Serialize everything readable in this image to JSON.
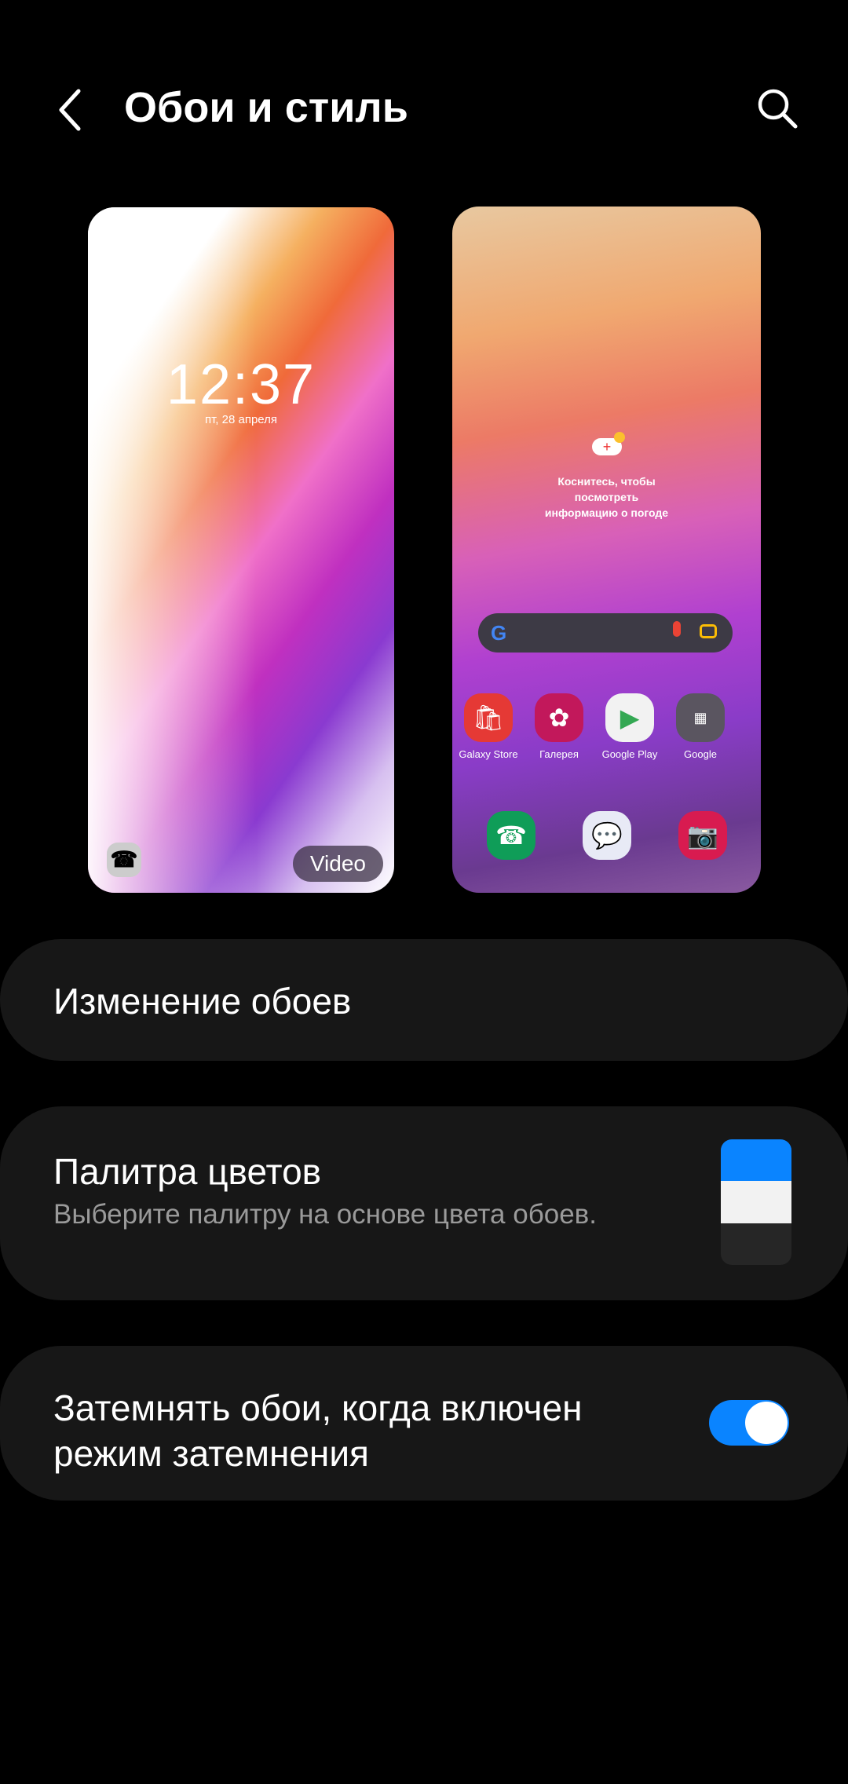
{
  "header": {
    "title": "Обои и стиль",
    "back_icon": "chevron-left-icon",
    "search_icon": "search-icon"
  },
  "lock_preview": {
    "time": "12:37",
    "date": "пт, 28 апреля",
    "badge": "Video"
  },
  "home_preview": {
    "weather_text": "Коснитесь, чтобы посмотреть информацию о погоде",
    "apps": [
      {
        "label": "Galaxy Store",
        "color": "#e53935"
      },
      {
        "label": "Галерея",
        "color": "#c2185b"
      },
      {
        "label": "Google Play",
        "color": "#f2f2f2"
      },
      {
        "label": "Google",
        "color": "#5a5560"
      }
    ],
    "dock": [
      {
        "name": "phone",
        "color": "#0f9d58"
      },
      {
        "name": "messages",
        "color": "#e8eaf6"
      },
      {
        "name": "camera",
        "color": "#d81b50"
      }
    ]
  },
  "settings": {
    "change_wallpaper": "Изменение обоев",
    "palette": {
      "title": "Палитра цветов",
      "subtitle": "Выберите палитру на основе цвета обоев.",
      "colors": [
        "#0a84ff",
        "#f2f2f2",
        "#262626"
      ]
    },
    "dim": {
      "label": "Затемнять обои, когда включен режим затемнения",
      "enabled": true
    }
  },
  "colors": {
    "accent": "#0a84ff",
    "card": "#171717",
    "background": "#000000"
  }
}
